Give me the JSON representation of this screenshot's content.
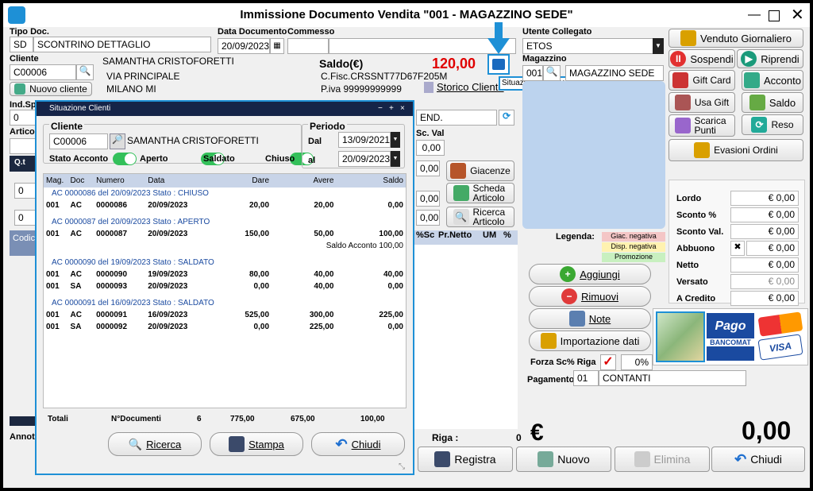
{
  "window": {
    "title": "Immissione Documento Vendita \"001 - MAGAZZINO SEDE\""
  },
  "tipo_doc": {
    "label": "Tipo Doc.",
    "code": "SD",
    "name": "SCONTRINO DETTAGLIO"
  },
  "data_doc": {
    "label": "Data Documento",
    "value": "20/09/2023"
  },
  "commesso": {
    "label": "Commesso",
    "value": ""
  },
  "cliente": {
    "label": "Cliente",
    "code": "C00006",
    "new_button": "Nuovo cliente",
    "name": "SAMANTHA CRISTOFORETTI",
    "address": "VIA PRINCIPALE",
    "city": "MILANO MI",
    "saldo_label": "Saldo(€)",
    "saldo_value": "120,00",
    "cf": "C.Fisc.CRSSNT77D67F205M",
    "piva": "P.iva 99999999999",
    "storico": "Storico Cliente",
    "tooltip": "Situazione Cliente"
  },
  "utente": {
    "label": "Utente Collegato",
    "value": "ETOS"
  },
  "magazzino": {
    "label": "Magazzino",
    "code": "001",
    "name": "MAGAZZINO SEDE"
  },
  "right_buttons": {
    "venduto": "Venduto Giornaliero",
    "sospendi": "Sospendi",
    "riprendi": "Riprendi",
    "gift_card": "Gift Card",
    "acconto": "Acconto",
    "usa_gift": "Usa Gift",
    "saldo": "Saldo",
    "scarica_punti": "Scarica Punti",
    "reso": "Reso",
    "evasioni": "Evasioni Ordini"
  },
  "bg_labels": {
    "ind_sp": "Ind.Sp",
    "artico": "Artico",
    "qt": "Q.t",
    "codic": "Codic",
    "annot": "Annot",
    "sc_val": "Sc. Val",
    "sc_val_value": "0,00",
    "val_a": "0,00",
    "val_b": "0,00",
    "val_c": "0,00",
    "zero_a": "0",
    "zero_b": "0",
    "zero_c": "0",
    "end": "END.",
    "col_sc": "%Sc",
    "col_prnetto": "Pr.Netto",
    "col_um": "UM",
    "col_pct": "%"
  },
  "article_buttons": {
    "giacenze": "Giacenze",
    "scheda": "Scheda Articolo",
    "ricerca": "Ricerca Articolo"
  },
  "legenda": {
    "label": "Legenda:",
    "items": [
      "Giac. negativa",
      "Disp. negativa",
      "Promozione"
    ]
  },
  "actions": {
    "aggiungi": "Aggiungi",
    "rimuovi": "Rimuovi",
    "note": "Note",
    "importazione": "Importazione dati"
  },
  "forza": {
    "label": "Forza Sc% Riga",
    "value": "0%"
  },
  "pagamento": {
    "label": "Pagamento",
    "code": "01",
    "name": "CONTANTI"
  },
  "summary": [
    {
      "label": "Lordo",
      "value": "€ 0,00"
    },
    {
      "label": "Sconto %",
      "value": "€ 0,00"
    },
    {
      "label": "Sconto Val.",
      "value": "€ 0,00"
    },
    {
      "label": "Abbuono",
      "value": "€ 0,00"
    },
    {
      "label": "Netto",
      "value": "€ 0,00"
    },
    {
      "label": "Versato",
      "value": "€ 0,00"
    },
    {
      "label": "A Credito",
      "value": "€ 0,00"
    }
  ],
  "payment_cards": {
    "bancomat_top": "Pago",
    "bancomat_bottom": "BANCOMAT",
    "visa": "VISA"
  },
  "footer": {
    "riga_label": "Riga :",
    "riga_value": "0",
    "currency": "€",
    "total": "0,00",
    "registra": "Registra",
    "nuovo": "Nuovo",
    "elimina": "Elimina",
    "chiudi": "Chiudi"
  },
  "dialog": {
    "title": "Situazione Clienti",
    "cliente_label": "Cliente",
    "cliente_code": "C00006",
    "cliente_name": "SAMANTHA CRISTOFORETTI",
    "periodo_label": "Periodo",
    "dal_label": "Dal",
    "dal_value": "13/09/2021",
    "al_label": "al",
    "al_value": "20/09/2023",
    "stato_label": "Stato Acconto",
    "aperto": "Aperto",
    "saldato": "Saldato",
    "chiuso": "Chiuso",
    "columns": [
      "Mag.",
      "Doc",
      "Numero",
      "Data",
      "Dare",
      "Avere",
      "Saldo"
    ],
    "groups": [
      {
        "header": "AC 0000086 del 20/09/2023    Stato : CHIUSO",
        "rows": [
          [
            "001",
            "AC",
            "0000086",
            "20/09/2023",
            "20,00",
            "20,00",
            "0,00"
          ]
        ],
        "note": ""
      },
      {
        "header": "AC 0000087 del 20/09/2023    Stato : APERTO",
        "rows": [
          [
            "001",
            "AC",
            "0000087",
            "20/09/2023",
            "150,00",
            "50,00",
            "100,00"
          ]
        ],
        "note": "Saldo Acconto 100,00"
      },
      {
        "header": "AC 0000090 del 19/09/2023    Stato : SALDATO",
        "rows": [
          [
            "001",
            "AC",
            "0000090",
            "19/09/2023",
            "80,00",
            "40,00",
            "40,00"
          ],
          [
            "001",
            "SA",
            "0000093",
            "20/09/2023",
            "0,00",
            "40,00",
            "0,00"
          ]
        ],
        "note": ""
      },
      {
        "header": "AC 0000091 del 16/09/2023    Stato : SALDATO",
        "rows": [
          [
            "001",
            "AC",
            "0000091",
            "16/09/2023",
            "525,00",
            "300,00",
            "225,00"
          ],
          [
            "001",
            "SA",
            "0000092",
            "20/09/2023",
            "0,00",
            "225,00",
            "0,00"
          ]
        ],
        "note": ""
      }
    ],
    "totals": {
      "label": "Totali",
      "ndoc_label": "N°Documenti",
      "ndoc": "6",
      "dare": "775,00",
      "avere": "675,00",
      "saldo": "100,00"
    },
    "ricerca": "Ricerca",
    "stampa": "Stampa",
    "chiudi": "Chiudi"
  },
  "colors": {
    "accent": "#1e90d6",
    "saldo_red": "#e00000",
    "dlg_header": "#152448",
    "toggle": "#33c05a"
  }
}
